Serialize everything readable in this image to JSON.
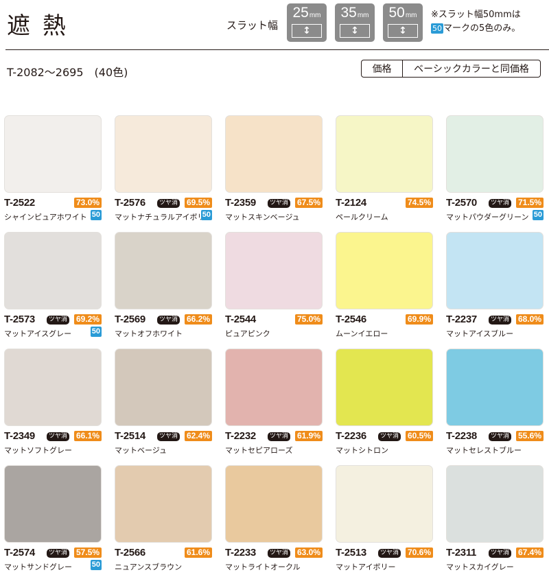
{
  "header": {
    "title": "遮熱",
    "slat_label": "スラット幅",
    "slats": [
      {
        "value": "25",
        "unit": "mm",
        "arrow": "↕"
      },
      {
        "value": "35",
        "unit": "mm",
        "arrow": "↕"
      },
      {
        "value": "50",
        "unit": "mm",
        "arrow": "↕"
      }
    ],
    "note_line1": "※スラット幅50mmは",
    "note_badge": "50",
    "note_line2": "マークの5色のみ。"
  },
  "series": "T-2082〜2695　(40色)",
  "price": {
    "label": "価格",
    "value": "ベーシックカラーと同価格"
  },
  "matte_label": "ツヤ消",
  "colors_meta": {
    "badge_color": "#2a9bd6",
    "pct_color": "#ef8c1a"
  },
  "swatches": [
    {
      "code": "T-2522",
      "name": "シャインピュアホワイト",
      "pct": "73.0%",
      "matte": false,
      "b50": "50",
      "color": "#f2efec"
    },
    {
      "code": "T-2576",
      "name": "マットナチュラルアイボリー",
      "pct": "69.5%",
      "matte": true,
      "b50": "50",
      "color": "#f6eadb"
    },
    {
      "code": "T-2359",
      "name": "マットスキンベージュ",
      "pct": "67.5%",
      "matte": true,
      "b50": "",
      "color": "#f6e2c8"
    },
    {
      "code": "T-2124",
      "name": "ペールクリーム",
      "pct": "74.5%",
      "matte": false,
      "b50": "",
      "color": "#f6f6c6"
    },
    {
      "code": "T-2570",
      "name": "マットパウダーグリーン",
      "pct": "71.5%",
      "matte": true,
      "b50": "50",
      "color": "#e2efe5"
    },
    {
      "code": "T-2573",
      "name": "マットアイスグレー",
      "pct": "69.2%",
      "matte": true,
      "b50": "50",
      "color": "#e2dfdc"
    },
    {
      "code": "T-2569",
      "name": "マットオフホワイト",
      "pct": "66.2%",
      "matte": true,
      "b50": "",
      "color": "#d9d3c9"
    },
    {
      "code": "T-2544",
      "name": "ピュアピンク",
      "pct": "75.0%",
      "matte": false,
      "b50": "",
      "color": "#efdbe1"
    },
    {
      "code": "T-2546",
      "name": "ムーンイエロー",
      "pct": "69.9%",
      "matte": false,
      "b50": "",
      "color": "#fbf58e"
    },
    {
      "code": "T-2237",
      "name": "マットアイスブルー",
      "pct": "68.0%",
      "matte": true,
      "b50": "",
      "color": "#c3e4f3"
    },
    {
      "code": "T-2349",
      "name": "マットソフトグレー",
      "pct": "66.1%",
      "matte": true,
      "b50": "",
      "color": "#e0d9d3"
    },
    {
      "code": "T-2514",
      "name": "マットベージュ",
      "pct": "62.4%",
      "matte": true,
      "b50": "",
      "color": "#d3c8bb"
    },
    {
      "code": "T-2232",
      "name": "マットセピアローズ",
      "pct": "61.9%",
      "matte": true,
      "b50": "",
      "color": "#e2b3ae"
    },
    {
      "code": "T-2236",
      "name": "マットシトロン",
      "pct": "60.5%",
      "matte": true,
      "b50": "",
      "color": "#e3e650"
    },
    {
      "code": "T-2238",
      "name": "マットセレストブルー",
      "pct": "55.6%",
      "matte": true,
      "b50": "",
      "color": "#7ecbe3"
    },
    {
      "code": "T-2574",
      "name": "マットサンドグレー",
      "pct": "57.5%",
      "matte": true,
      "b50": "50",
      "color": "#aaa5a1"
    },
    {
      "code": "T-2566",
      "name": "ニュアンスブラウン",
      "pct": "61.6%",
      "matte": false,
      "b50": "",
      "color": "#e3cbaf"
    },
    {
      "code": "T-2233",
      "name": "マットライトオークル",
      "pct": "63.0%",
      "matte": true,
      "b50": "",
      "color": "#e9c99e"
    },
    {
      "code": "T-2513",
      "name": "マットアイボリー",
      "pct": "70.6%",
      "matte": true,
      "b50": "",
      "color": "#f4f0e0"
    },
    {
      "code": "T-2311",
      "name": "マットスカイグレー",
      "pct": "67.4%",
      "matte": true,
      "b50": "",
      "color": "#dbe0de"
    }
  ]
}
